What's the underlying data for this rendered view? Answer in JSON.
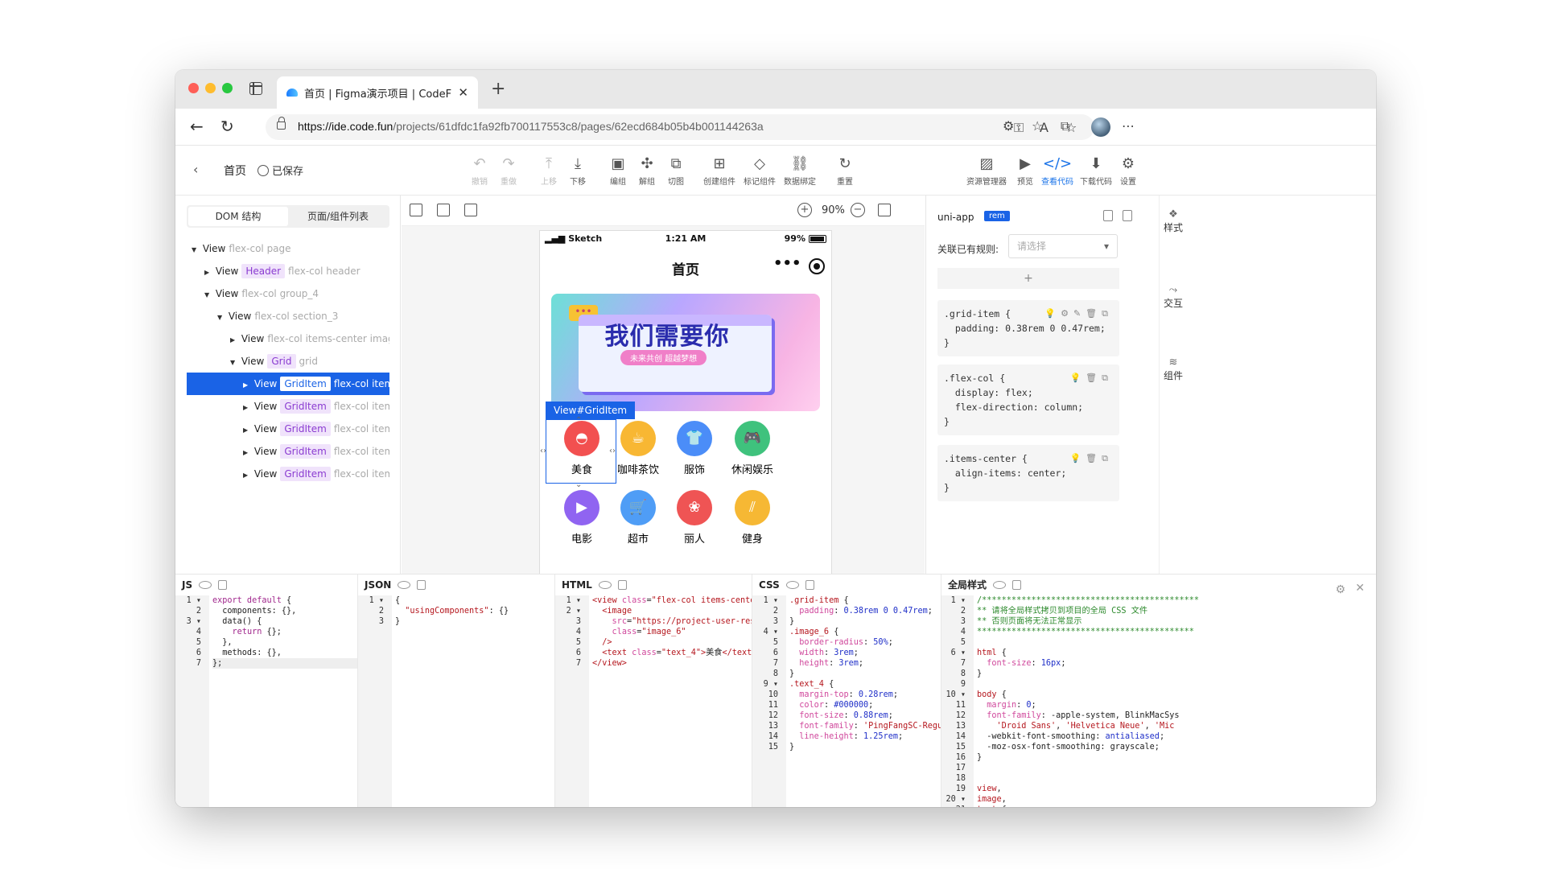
{
  "browser": {
    "tab_title": "首页 | Figma演示项目 | CodeFu",
    "url_host": "https://ide.code.fun",
    "url_path": "/projects/61dfdc1fa92fb700117553c8/pages/62ecd684b05b4b001144263a"
  },
  "header": {
    "page_name": "首页",
    "saved_label": "已保存",
    "tools": [
      {
        "icon": "↶",
        "label": "撤销"
      },
      {
        "icon": "↷",
        "label": "重做"
      },
      {
        "icon": "⤒",
        "label": "上移"
      },
      {
        "icon": "⤓",
        "label": "下移"
      },
      {
        "icon": "▣",
        "label": "编组"
      },
      {
        "icon": "✣",
        "label": "解组"
      },
      {
        "icon": "⧉",
        "label": "切图"
      },
      {
        "icon": "⊞",
        "label": "创建组件"
      },
      {
        "icon": "◇",
        "label": "标记组件"
      },
      {
        "icon": "⛓",
        "label": "数据绑定"
      },
      {
        "icon": "↻",
        "label": "重置"
      }
    ],
    "right_tools": [
      {
        "icon": "▨",
        "label": "资源管理器"
      },
      {
        "icon": "▶",
        "label": "预览"
      },
      {
        "icon": "</>",
        "label": "查看代码"
      },
      {
        "icon": "⬇",
        "label": "下载代码"
      },
      {
        "icon": "⚙",
        "label": "设置"
      }
    ]
  },
  "left_panel": {
    "tabs": [
      "DOM 结构",
      "页面/组件列表"
    ],
    "tree": [
      {
        "kw": "View",
        "tag": "",
        "cls": "flex-col page"
      },
      {
        "kw": "View",
        "tag": "Header",
        "cls": "flex-col header"
      },
      {
        "kw": "View",
        "tag": "",
        "cls": "flex-col group_4"
      },
      {
        "kw": "View",
        "tag": "",
        "cls": "flex-col section_3"
      },
      {
        "kw": "View",
        "tag": "",
        "cls": "flex-col items-center image-wra"
      },
      {
        "kw": "View",
        "tag": "Grid",
        "cls": "grid"
      },
      {
        "kw": "View",
        "tag": "GridItem",
        "cls": "flex-col items-cen"
      },
      {
        "kw": "View",
        "tag": "GridItem",
        "cls": "flex-col items-cer"
      },
      {
        "kw": "View",
        "tag": "GridItem",
        "cls": "flex-col items-cer"
      },
      {
        "kw": "View",
        "tag": "GridItem",
        "cls": "flex-col items-cer"
      },
      {
        "kw": "View",
        "tag": "GridItem",
        "cls": "flex-col items-cer"
      }
    ]
  },
  "canvas": {
    "zoom": "90%",
    "status_carrier": "Sketch",
    "status_time": "1:21 AM",
    "status_battery": "99%",
    "phone_title": "首页",
    "banner_title": "我们需要你",
    "banner_sub": "未来共创  超越梦想",
    "selection_label": "View#GridItem",
    "grid_items": [
      {
        "label": "美食",
        "icon": "food-icon",
        "color": "#f25050"
      },
      {
        "label": "咖啡茶饮",
        "icon": "coffee-icon",
        "color": "#f8b733"
      },
      {
        "label": "服饰",
        "icon": "clothes-icon",
        "color": "#4b8df8"
      },
      {
        "label": "休闲娱乐",
        "icon": "game-icon",
        "color": "#3fc27d"
      },
      {
        "label": "电影",
        "icon": "movie-icon",
        "color": "#9064f1"
      },
      {
        "label": "超市",
        "icon": "cart-icon",
        "color": "#4f9df6"
      },
      {
        "label": "丽人",
        "icon": "beauty-icon",
        "color": "#ef5454"
      },
      {
        "label": "健身",
        "icon": "fitness-icon",
        "color": "#f6b834"
      }
    ]
  },
  "right_panel": {
    "title": "uni-app",
    "badge": "rem",
    "rule_label": "关联已有规则:",
    "select_placeholder": "请选择",
    "add": "+",
    "rules": [
      ".grid-item {\n  padding: 0.38rem 0 0.47rem;\n}",
      ".flex-col {\n  display: flex;\n  flex-direction: column;\n}",
      ".items-center {\n  align-items: center;\n}"
    ],
    "side_tabs": [
      "样式",
      "交互",
      "组件"
    ]
  },
  "code_panes": {
    "js_title": "JS",
    "json_title": "JSON",
    "html_title": "HTML",
    "css_title": "CSS",
    "global_title": "全局样式"
  }
}
